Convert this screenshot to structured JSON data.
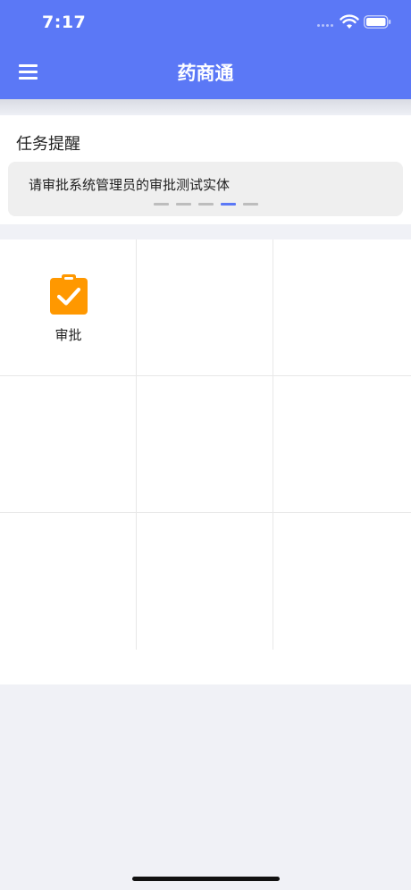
{
  "status_bar": {
    "time": "7:17"
  },
  "header": {
    "title": "药商通",
    "menu_icon": "hamburger-menu-icon"
  },
  "reminders": {
    "title": "任务提醒",
    "notice": "请审批系统管理员的审批测试实体",
    "pager": {
      "count": 5,
      "active_index": 3
    }
  },
  "grid": {
    "items": [
      {
        "label": "审批",
        "icon": "clipboard-check-icon",
        "icon_color": "#ff9800"
      }
    ]
  },
  "colors": {
    "accent": "#5b78f6",
    "background": "#f0f1f6"
  }
}
